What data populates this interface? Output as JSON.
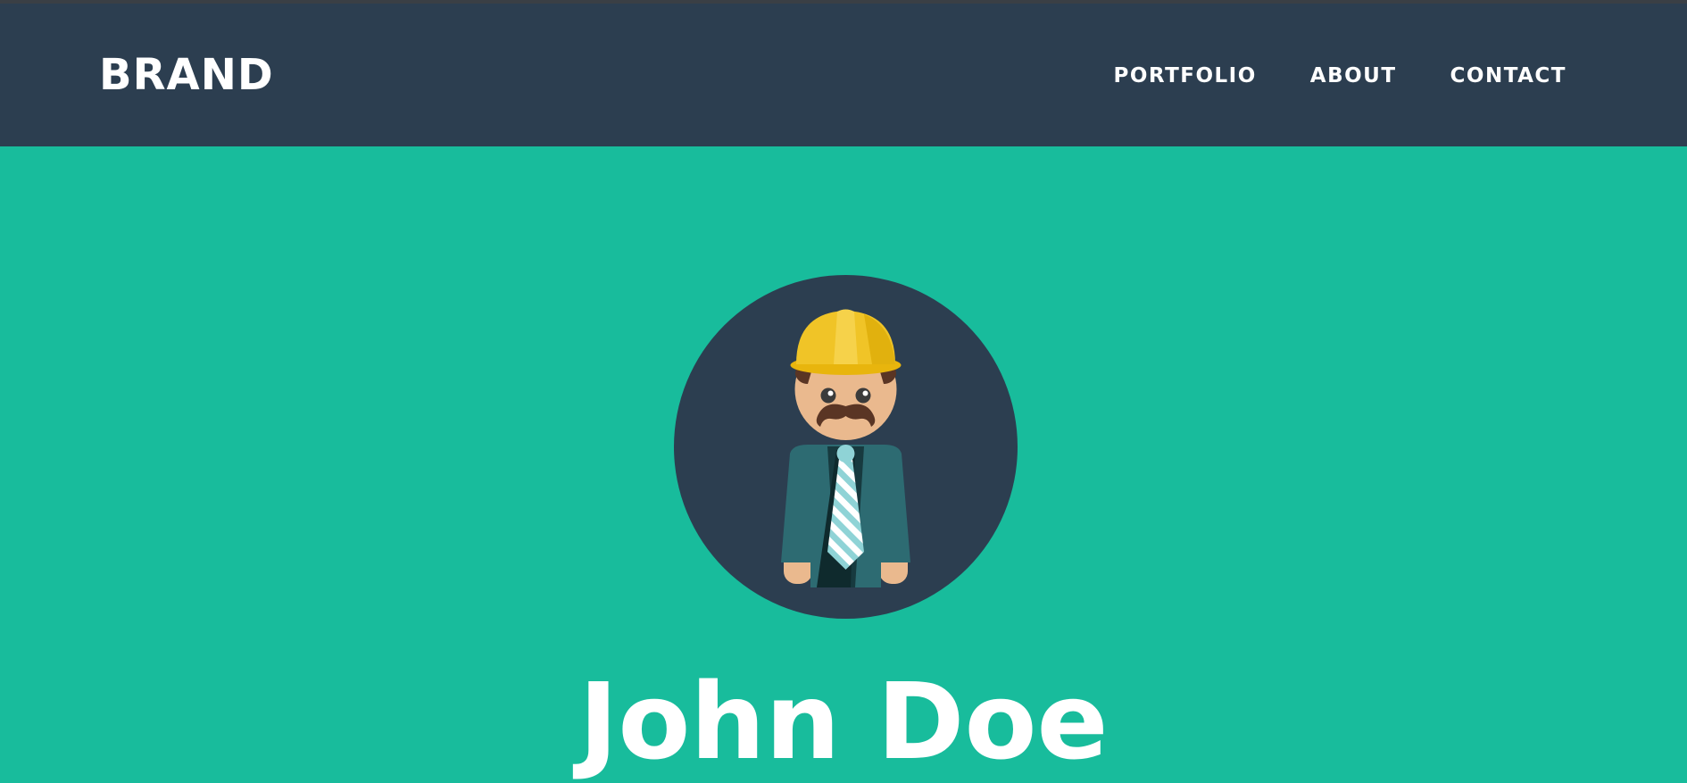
{
  "colors": {
    "navbar_bg": "#2c3e50",
    "hero_bg": "#18bc9c",
    "text": "#ffffff",
    "avatar_circle": "#2c3e50"
  },
  "navbar": {
    "brand": "BRAND",
    "links": [
      {
        "label": "PORTFOLIO"
      },
      {
        "label": "ABOUT"
      },
      {
        "label": "CONTACT"
      }
    ]
  },
  "hero": {
    "avatar_icon": "construction-worker-avatar-icon",
    "name": "John Doe"
  }
}
